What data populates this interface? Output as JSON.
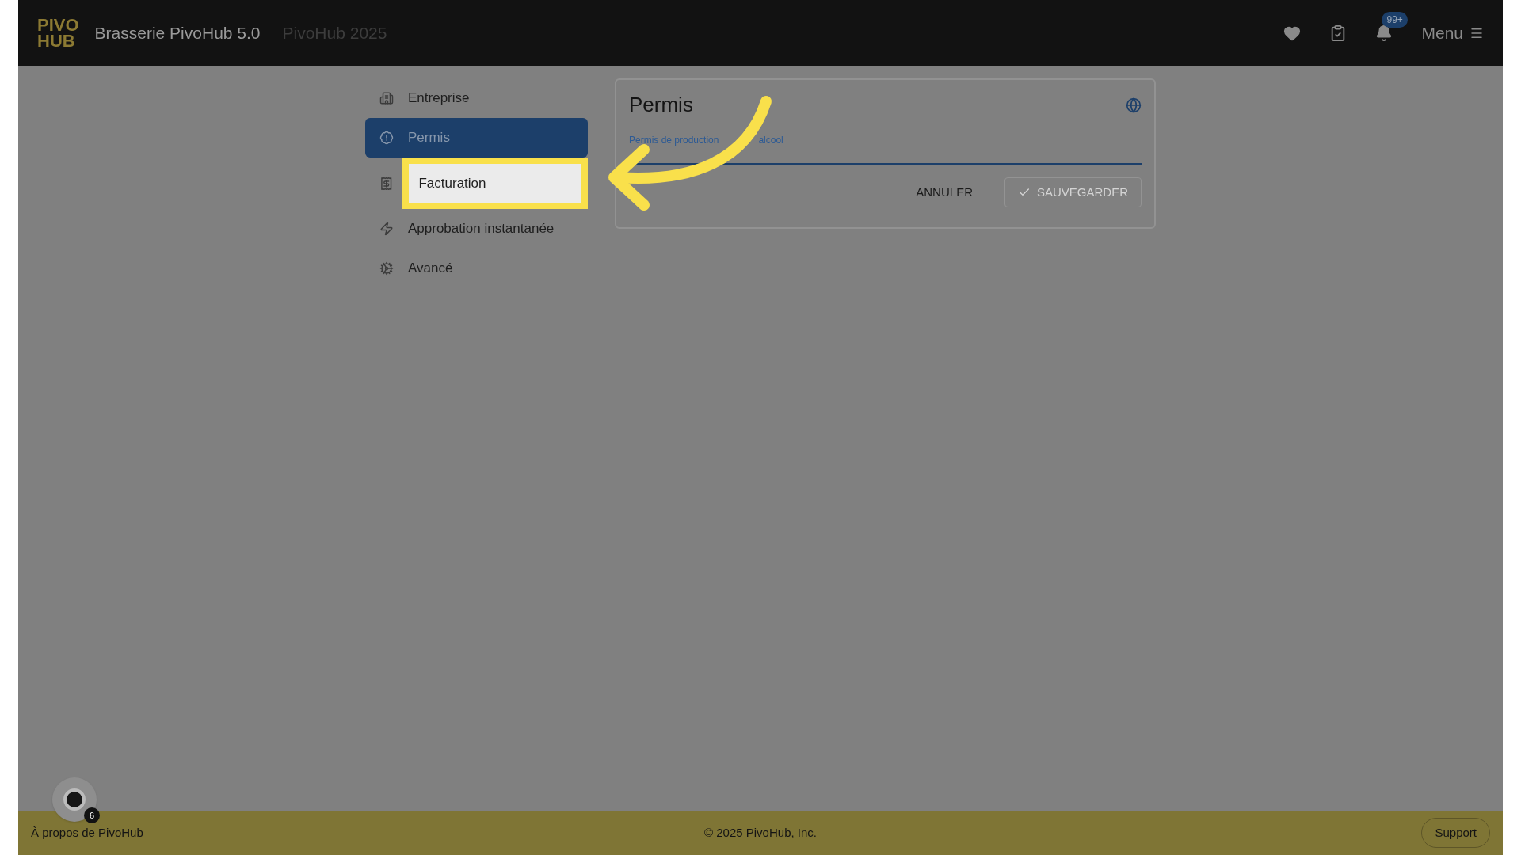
{
  "header": {
    "logo": [
      "PIVO",
      "HUB"
    ],
    "title": "Brasserie PivoHub 5.0",
    "subtitle": "PivoHub 2025",
    "notifications_badge": "99+",
    "menu_label": "Menu"
  },
  "sidebar": {
    "items": [
      {
        "label": "Entreprise",
        "selected": false,
        "highlighted": false
      },
      {
        "label": "Permis",
        "selected": true,
        "highlighted": false
      },
      {
        "label": "Facturation",
        "selected": false,
        "highlighted": true
      },
      {
        "label": "Approbation instantanée",
        "selected": false,
        "highlighted": false
      },
      {
        "label": "Avancé",
        "selected": false,
        "highlighted": false
      }
    ]
  },
  "card": {
    "title": "Permis",
    "field": {
      "label": [
        "Permis de production",
        "alcool"
      ]
    },
    "buttons": [
      {
        "label": "ANNULER",
        "kind": "text",
        "disabled": false
      },
      {
        "label": "SAUVEGARDER",
        "kind": "save",
        "disabled": true
      }
    ]
  },
  "chat_widget": {
    "badge": "6"
  },
  "footer": {
    "left": "À propos de PivoHub",
    "center": "© 2025 PivoHub, Inc.",
    "button": "Support"
  }
}
